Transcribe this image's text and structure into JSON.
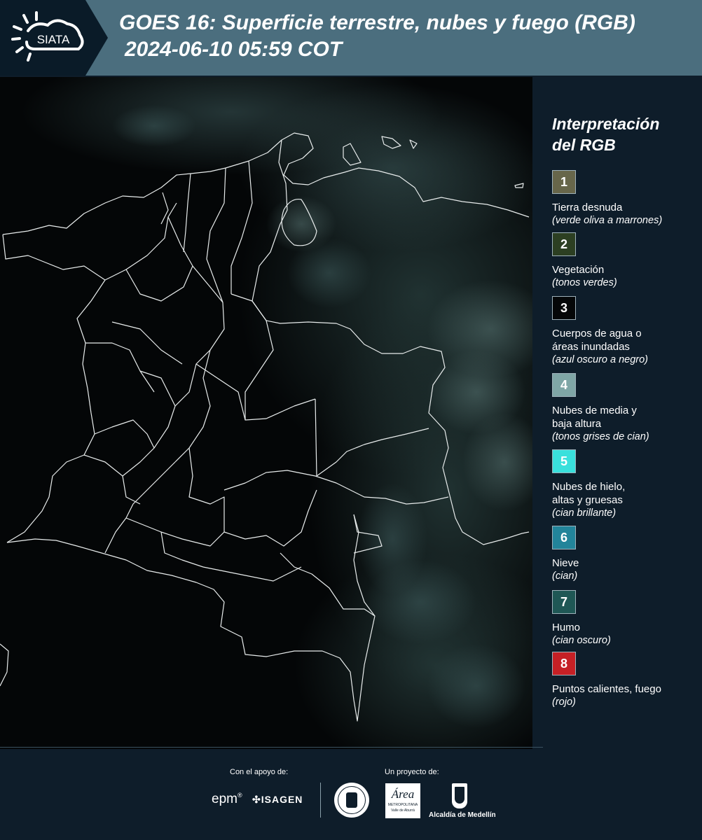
{
  "header": {
    "logo_text": "SIATA",
    "title_line1": "GOES 16: Superficie terrestre, nubes y fuego (RGB)",
    "title_line2": "2024-06-10 05:59 COT"
  },
  "legend": {
    "title_line1": "Interpretación",
    "title_line2": "del RGB",
    "items": [
      {
        "num": "1",
        "color": "#67664a",
        "label": [
          "Tierra desnuda"
        ],
        "sub": "(verde oliva a marrones)"
      },
      {
        "num": "2",
        "color": "#2c3f22",
        "label": [
          "Vegetación"
        ],
        "sub": "(tonos verdes)"
      },
      {
        "num": "3",
        "color": "#050708",
        "label": [
          "Cuerpos de agua o",
          "áreas inundadas"
        ],
        "sub": "(azul oscuro a negro)"
      },
      {
        "num": "4",
        "color": "#7fa6a6",
        "label": [
          "Nubes de media y",
          "baja altura"
        ],
        "sub": "(tonos grises de cian)"
      },
      {
        "num": "5",
        "color": "#39e0dc",
        "label": [
          "Nubes de hielo,",
          "altas y gruesas"
        ],
        "sub": "(cian brillante)"
      },
      {
        "num": "6",
        "color": "#22849a",
        "label": [
          "Nieve"
        ],
        "sub": "(cian)"
      },
      {
        "num": "7",
        "color": "#1f5755",
        "label": [
          "Humo"
        ],
        "sub": "(cian oscuro)"
      },
      {
        "num": "8",
        "color": "#c62025",
        "label": [
          "Puntos calientes, fuego"
        ],
        "sub": "(rojo)"
      }
    ]
  },
  "footer": {
    "support_caption": "Con el apoyo de:",
    "project_caption": "Un proyecto de:",
    "sponsor_epm": "epm",
    "sponsor_isagen": "ISAGEN",
    "partner_area_line1": "Área",
    "partner_area_line2": "METROPOLITANA",
    "partner_area_line3": "Valle de Aburrá",
    "partner_alcaldia": "Alcaldía de Medellín"
  }
}
